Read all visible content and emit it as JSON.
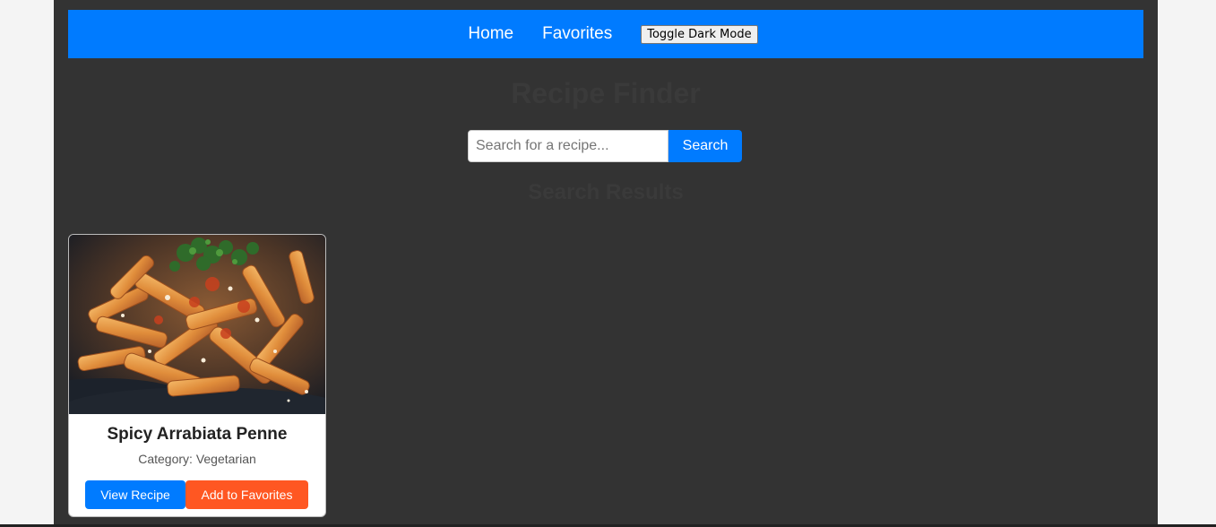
{
  "nav": {
    "home_label": "Home",
    "favorites_label": "Favorites",
    "toggle_label": "Toggle Dark Mode",
    "bg_color": "#007bff"
  },
  "page": {
    "title": "Recipe Finder",
    "results_heading": "Search Results",
    "bg_color": "#333333"
  },
  "search": {
    "placeholder": "Search for a recipe...",
    "value": "",
    "button_label": "Search"
  },
  "results": [
    {
      "title": "Spicy Arrabiata Penne",
      "category": "Category: Vegetarian",
      "view_label": "View Recipe",
      "favorite_label": "Add to Favorites",
      "image_icon": "pasta-dish-photo"
    }
  ],
  "colors": {
    "primary": "#007bff",
    "favorite": "#ff5722"
  }
}
